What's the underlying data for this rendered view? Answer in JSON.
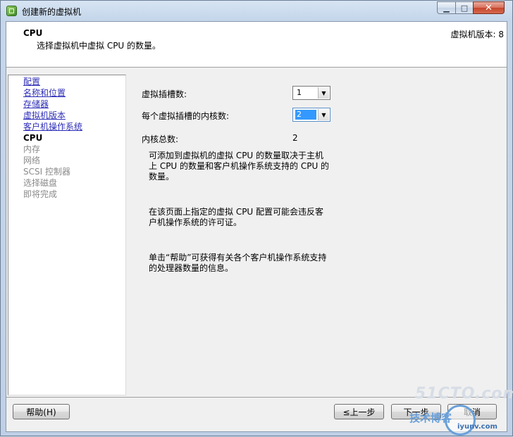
{
  "window": {
    "title": "创建新的虚拟机",
    "minimize_glyph": "▁",
    "maximize_glyph": "□",
    "close_glyph": "✕"
  },
  "header": {
    "title": "CPU",
    "subtitle": "选择虚拟机中虚拟 CPU 的数量。",
    "version": "虚拟机版本: 8"
  },
  "nav": {
    "items": [
      {
        "label": "配置",
        "state": "link"
      },
      {
        "label": "名称和位置",
        "state": "link"
      },
      {
        "label": "存储器",
        "state": "link"
      },
      {
        "label": "虚拟机版本",
        "state": "link"
      },
      {
        "label": "客户机操作系统",
        "state": "link"
      },
      {
        "label": "CPU",
        "state": "current"
      },
      {
        "label": "内存",
        "state": "future"
      },
      {
        "label": "网络",
        "state": "future"
      },
      {
        "label": "SCSI 控制器",
        "state": "future"
      },
      {
        "label": "选择磁盘",
        "state": "future"
      },
      {
        "label": "即将完成",
        "state": "future"
      }
    ]
  },
  "form": {
    "sockets_label": "虚拟插槽数:",
    "sockets_value": "1",
    "cores_label": "每个虚拟插槽的内核数:",
    "cores_value": "2",
    "total_label": "内核总数:",
    "total_value": "2"
  },
  "info": {
    "p1": "可添加到虚拟机的虚拟 CPU 的数量取决于主机上 CPU 的数量和客户机操作系统支持的 CPU 的数量。",
    "p2": "在该页面上指定的虚拟 CPU 配置可能会违反客户机操作系统的许可证。",
    "p3": "单击“帮助”可获得有关各个客户机操作系统支持的处理器数量的信息。"
  },
  "buttons": {
    "help": "帮助(H)",
    "back": "≤上一步",
    "next": "下一步",
    "cancel": "取消"
  },
  "watermark": {
    "brand": "51CTO.com",
    "slogan": "技术博客",
    "site": "iyunv.com"
  }
}
